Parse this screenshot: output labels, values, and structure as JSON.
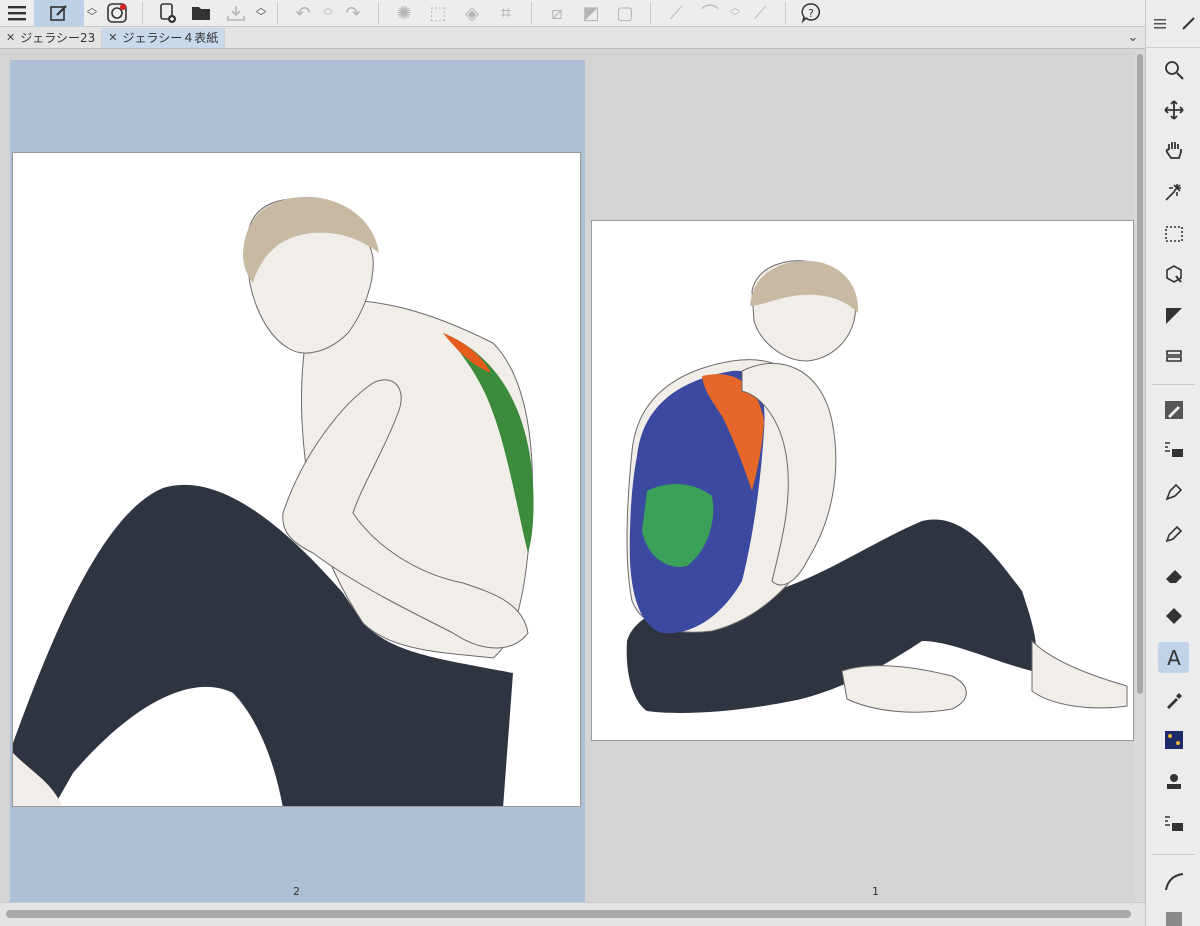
{
  "tabs": [
    {
      "label": "ジェラシー23",
      "active": false
    },
    {
      "label": "ジェラシー４表紙",
      "active": true
    }
  ],
  "pages": {
    "left_number": "2",
    "right_number": "1"
  },
  "toolbar_icons": [
    "menu-icon",
    "edit-icon",
    "chevron-updown-icon",
    "app-icon",
    "new-file-icon",
    "open-folder-icon",
    "save-icon",
    "undo-icon",
    "redo-icon",
    "loading-icon",
    "transform-icon",
    "fill-icon",
    "crop-icon",
    "clear-selection-icon",
    "invert-icon",
    "select-all-icon",
    "pen-line-icon",
    "brush-icon",
    "erase-icon",
    "help-icon"
  ],
  "right_tools": [
    "zoom-icon",
    "move-icon",
    "hand-icon",
    "magic-wand-icon",
    "selection-icon",
    "object-icon",
    "ruler-icon",
    "layer-move-icon",
    "pen-icon",
    "stamp-icon",
    "nib-icon",
    "marker-icon",
    "eraser-icon",
    "fill-bucket-icon",
    "text-icon",
    "eyedropper-icon",
    "texture-icon",
    "stamp2-icon",
    "spray-icon",
    "curve-icon",
    "gradient-icon"
  ],
  "colors": {
    "accent": "#bcd0e6",
    "spread_bg": "#aec0d5",
    "canvas_bg": "#d4d4d4"
  }
}
